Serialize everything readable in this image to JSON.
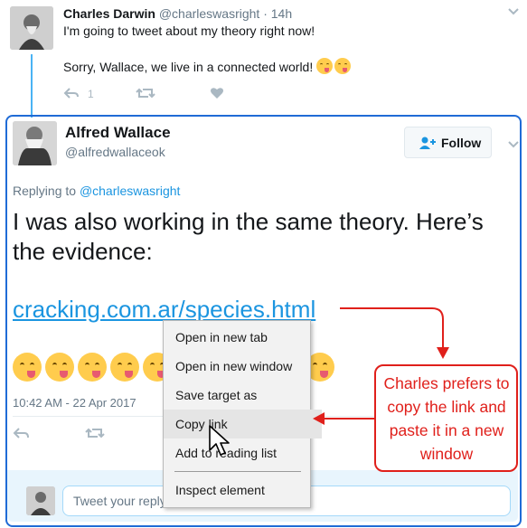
{
  "parent_tweet": {
    "name": "Charles Darwin",
    "handle": "@charleswasright",
    "separator": "·",
    "time": "14h",
    "line1": "I'm going to tweet about my theory right now!",
    "line2": "Sorry, Wallace, we live in a connected world!",
    "reply_count": "1"
  },
  "reply_tweet": {
    "name": "Alfred Wallace",
    "handle": "@alfredwallaceok",
    "follow_label": "Follow",
    "replying_prefix": "Replying to",
    "replying_handle": "@charleswasright",
    "text": "I was also working in the same theory. Here’s the evidence:",
    "link": "cracking.com.ar/species.html",
    "timestamp": "10:42 AM - 22 Apr 2017",
    "emoji_count": 10
  },
  "context_menu": {
    "items": [
      "Open in new tab",
      "Open in new window",
      "Save target as",
      "Copy link",
      "Add to reading list",
      "Inspect element"
    ],
    "hovered": "Copy link"
  },
  "annotation": {
    "text": "Charles prefers to copy the link and paste it in a new window",
    "color": "#e0201b"
  },
  "reply_box": {
    "placeholder": "Tweet your reply"
  },
  "colors": {
    "link": "#1b95e0",
    "highlight_border": "#1f6bd6",
    "thread_line": "#4ab3f4"
  }
}
